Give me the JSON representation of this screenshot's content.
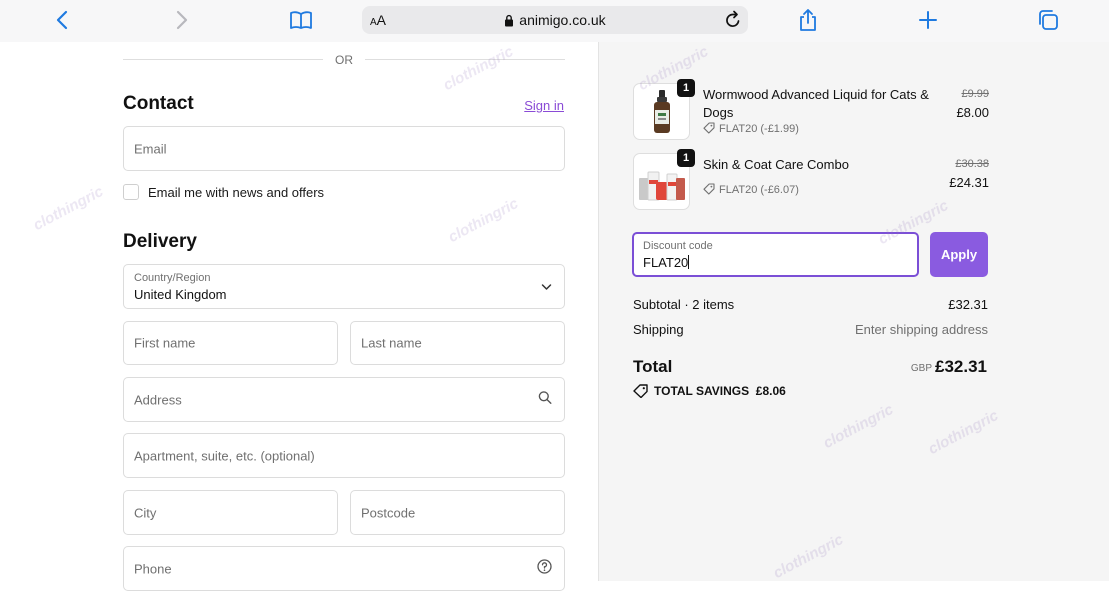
{
  "browser": {
    "text_size_label_small": "A",
    "text_size_label_large": "A",
    "url": "animigo.co.uk"
  },
  "checkout": {
    "or_divider": "OR",
    "contact": {
      "title": "Contact",
      "sign_in": "Sign in",
      "email_placeholder": "Email",
      "newsletter_label": "Email me with news and offers"
    },
    "delivery": {
      "title": "Delivery",
      "country_label": "Country/Region",
      "country_value": "United Kingdom",
      "first_name_placeholder": "First name",
      "last_name_placeholder": "Last name",
      "address_placeholder": "Address",
      "apartment_placeholder": "Apartment, suite, etc. (optional)",
      "city_placeholder": "City",
      "postcode_placeholder": "Postcode",
      "phone_placeholder": "Phone"
    }
  },
  "order_summary": {
    "items": [
      {
        "qty": "1",
        "name": "Wormwood Advanced Liquid for Cats & Dogs",
        "discount": "FLAT20 (-£1.99)",
        "original_price": "£9.99",
        "price": "£8.00"
      },
      {
        "qty": "1",
        "name": "Skin & Coat Care Combo",
        "discount": "FLAT20 (-£6.07)",
        "original_price": "£30.38",
        "price": "£24.31"
      }
    ],
    "discount_code": {
      "label": "Discount code",
      "value": "FLAT20",
      "apply_label": "Apply"
    },
    "subtotal_label": "Subtotal · 2 items",
    "subtotal_value": "£32.31",
    "shipping_label": "Shipping",
    "shipping_value": "Enter shipping address",
    "total_label": "Total",
    "total_currency": "GBP",
    "total_value": "£32.31",
    "savings_label": "TOTAL SAVINGS",
    "savings_value": "£8.06"
  },
  "watermark": "clothingric",
  "colors": {
    "accent": "#8a5be0",
    "link": "#8a4bd6",
    "chrome_icon": "#1a73e8"
  }
}
